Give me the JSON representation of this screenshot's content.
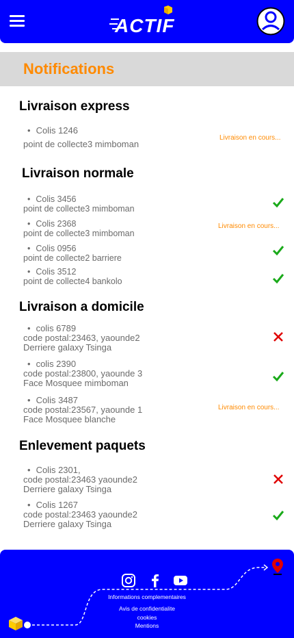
{
  "header": {
    "logo_text": "ACTIF",
    "menu_icon": "hamburger-menu-icon",
    "profile_icon": "user-profile-icon"
  },
  "page": {
    "title": "Notifications"
  },
  "sections": [
    {
      "title": "Livraison express",
      "items": [
        {
          "colis": "Colis 1246",
          "lines": [
            "point de collecte3 mimboman"
          ],
          "status": "Livraison en cours..."
        }
      ]
    },
    {
      "title": "Livraison normale",
      "items": [
        {
          "colis": "Colis 3456",
          "lines": [
            "point de collecte3 mimboman"
          ],
          "status": "check"
        },
        {
          "colis": "Colis 2368",
          "lines": [
            "point de collecte3 mimboman"
          ],
          "status": "Livraison en cours..."
        },
        {
          "colis": "Colis 0956",
          "lines": [
            "point de collecte2  barriere"
          ],
          "status": "check"
        },
        {
          "colis": "Colis 3512",
          "lines": [
            "point de collecte4 bankolo"
          ],
          "status": "check"
        }
      ]
    },
    {
      "title": "Livraison a domicile",
      "items": [
        {
          "colis": "colis 6789",
          "lines": [
            "code postal:23463, yaounde2",
            "Derriere galaxy Tsinga"
          ],
          "status": "cross"
        },
        {
          "colis": "colis 2390",
          "lines": [
            "code postal:23800, yaounde 3",
            "Face Mosquee mimboman"
          ],
          "status": "check"
        },
        {
          "colis": "Colis 3487",
          "lines": [
            "code postal:23567, yaounde 1",
            "Face Mosquee blanche"
          ],
          "status": "Livraison en cours..."
        }
      ]
    },
    {
      "title": "Enlevement paquets",
      "items": [
        {
          "colis": "Colis 2301,",
          "lines": [
            "code postal:23463 yaounde2",
            "Derriere galaxy Tsinga"
          ],
          "status": "cross"
        },
        {
          "colis": "Colis 1267",
          "lines": [
            "code postal:23463 yaounde2",
            "Derriere galaxy Tsinga"
          ],
          "status": "check"
        }
      ]
    }
  ],
  "footer": {
    "links": [
      "Informations complementaires",
      "Avis de confidentialite",
      "cookies",
      "Mentions"
    ],
    "social_icons": [
      "instagram-icon",
      "facebook-icon",
      "youtube-icon"
    ]
  },
  "colors": {
    "brand_blue": "#0000ff",
    "accent_orange": "#ff8a00",
    "check_green": "#1aaa1a",
    "cross_red": "#e00000"
  }
}
